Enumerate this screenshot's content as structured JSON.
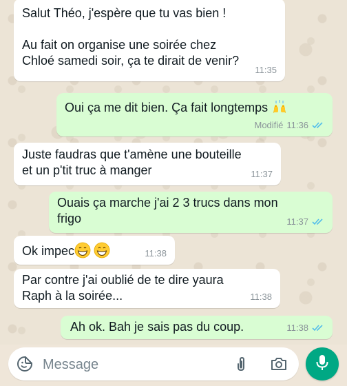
{
  "messages": [
    {
      "direction": "in",
      "text": "Salut Théo, j'espère que tu vas bien !\n\nAu fait on organise une soirée chez\nChloé samedi soir, ça te dirait de venir?",
      "time": "11:35"
    },
    {
      "direction": "out",
      "text": "Oui ça me dit bien. Ça fait longtemps",
      "emoji": "raising-hands",
      "edited_label": "Modifié",
      "time": "11:36",
      "status": "read"
    },
    {
      "direction": "in",
      "text": "Juste faudras que t'amène une bouteille\net un p'tit truc à manger",
      "time": "11:37"
    },
    {
      "direction": "out",
      "text": "Ouais ça marche j'ai 2 3 trucs dans mon\nfrigo",
      "time": "11:37",
      "status": "read"
    },
    {
      "direction": "in",
      "text": "Ok impec",
      "emoji": "grinning-face x2",
      "time": "11:38"
    },
    {
      "direction": "in",
      "text": "Par contre j'ai oublié de te dire yaura\nRaph à la soirée...",
      "time": "11:38"
    },
    {
      "direction": "out",
      "text": "Ah ok. Bah je sais pas du coup.",
      "time": "11:38",
      "status": "read"
    }
  ],
  "composer": {
    "placeholder": "Message",
    "icons": [
      "emoji-sticker-icon",
      "paperclip-icon",
      "camera-icon",
      "microphone-icon"
    ]
  },
  "colors": {
    "incoming": "#ffffff",
    "outgoing": "#d9fdd3",
    "read_ticks": "#53bdeb",
    "accent": "#00a884"
  }
}
